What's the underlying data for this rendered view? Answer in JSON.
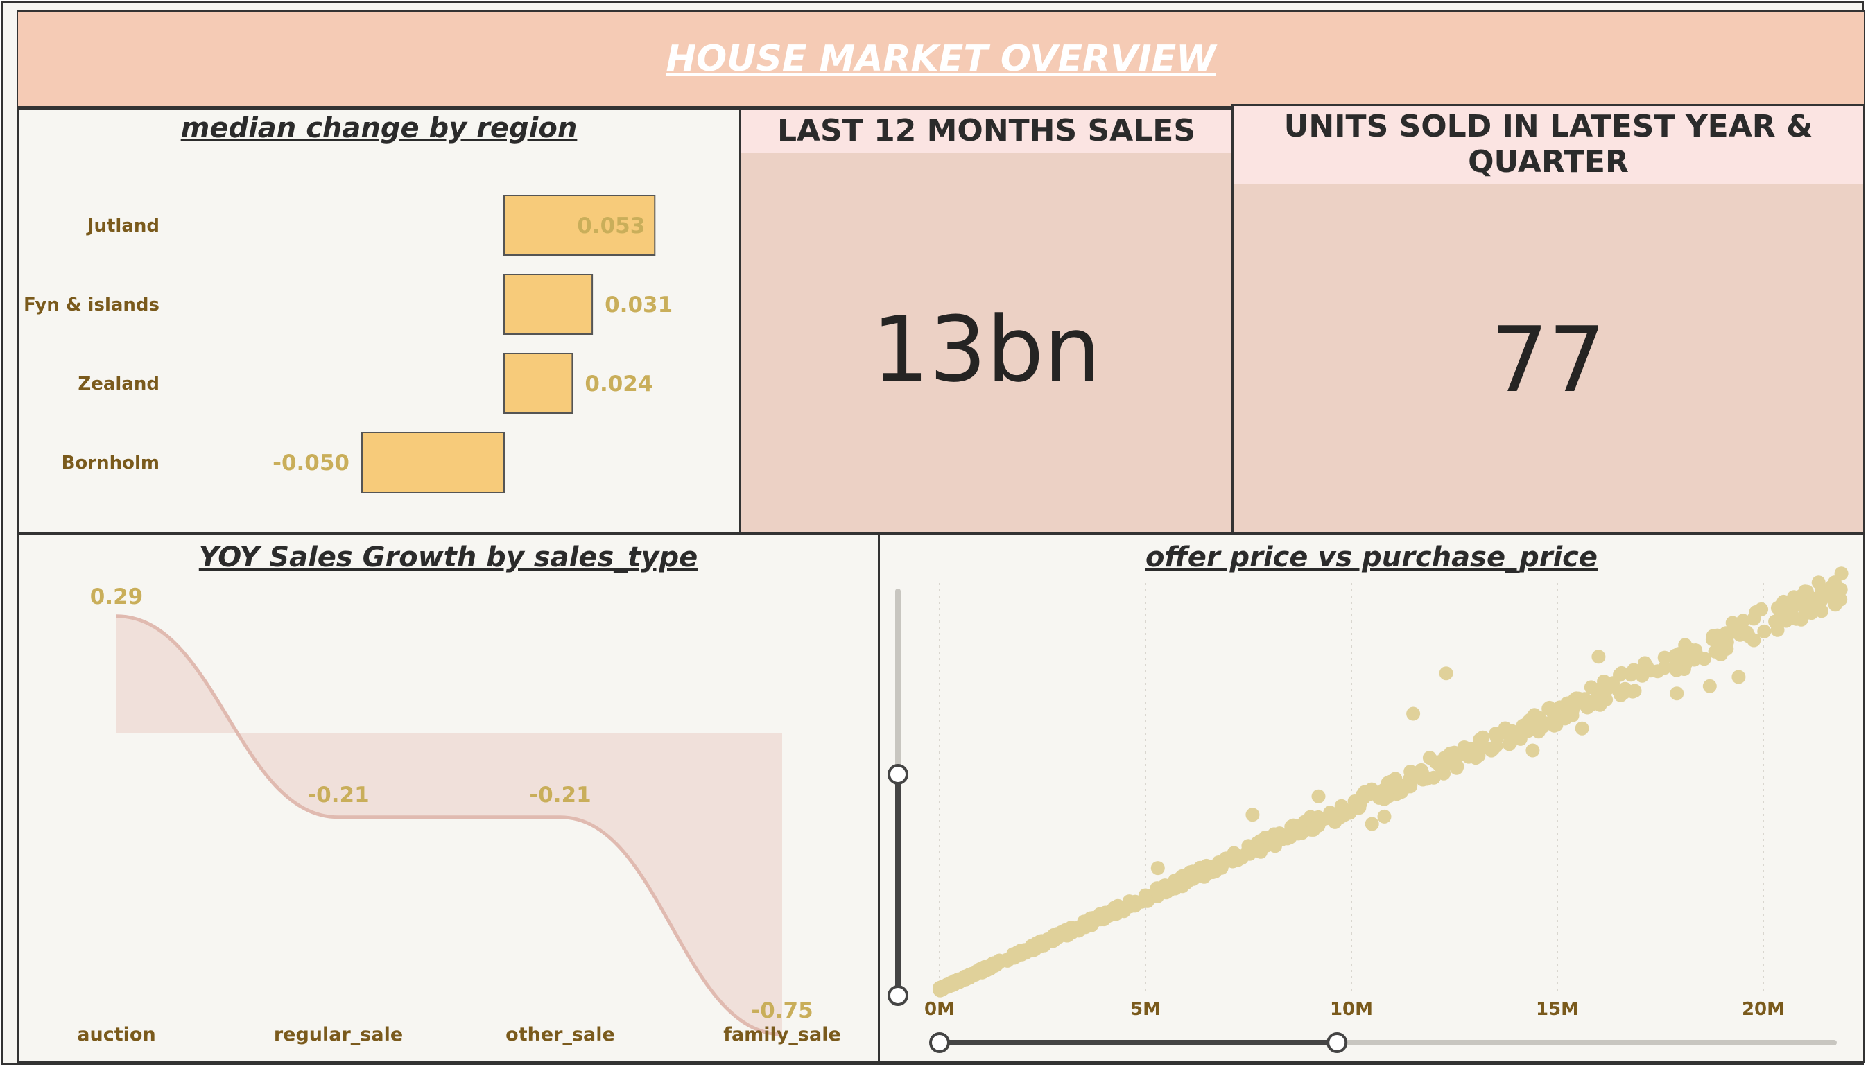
{
  "header": {
    "title": "HOUSE MARKET OVERVIEW"
  },
  "median_change": {
    "title": "median change by region",
    "chart_data": {
      "type": "bar",
      "orientation": "horizontal",
      "categories": [
        "Jutland",
        "Fyn & islands",
        "Zealand",
        "Bornholm"
      ],
      "values": [
        0.053,
        0.031,
        0.024,
        -0.05
      ],
      "labels": [
        "0.053",
        "0.031",
        "0.024",
        "-0.050"
      ],
      "bar_color": "#f7cb7a",
      "label_color": "#c9ae5a",
      "category_color": "#7a5a1c"
    }
  },
  "last12": {
    "title": "LAST 12 MONTHS SALES",
    "value": "13bn"
  },
  "units": {
    "title": "UNITS SOLD IN LATEST YEAR & QUARTER",
    "value": "77"
  },
  "yoy": {
    "title": "YOY Sales Growth by sales_type",
    "chart_data": {
      "type": "area",
      "categories": [
        "auction",
        "regular_sale",
        "other_sale",
        "family_sale"
      ],
      "values": [
        0.29,
        -0.21,
        -0.21,
        -0.75
      ],
      "labels": [
        "0.29",
        "-0.21",
        "-0.21",
        "-0.75"
      ],
      "line_color": "#e0bab0",
      "fill_color": "#f0e0da"
    }
  },
  "scatter": {
    "title": "offer price vs purchase_price",
    "chart_data": {
      "type": "scatter",
      "x_ticks": [
        "0M",
        "5M",
        "10M",
        "15M",
        "20M"
      ],
      "x_tick_values": [
        0,
        5,
        10,
        15,
        20
      ],
      "unit": "M",
      "xlim": [
        0,
        22.2
      ],
      "trend_slope": 1.0,
      "point_color": "#e0d19a",
      "outliers": [
        {
          "x": 12.3,
          "y": 17.2
        },
        {
          "x": 16.0,
          "y": 18.1
        },
        {
          "x": 11.5,
          "y": 15.0
        },
        {
          "x": 12.9,
          "y": 13.1
        },
        {
          "x": 13.8,
          "y": 13.9
        },
        {
          "x": 15.6,
          "y": 14.2
        },
        {
          "x": 17.9,
          "y": 16.1
        },
        {
          "x": 18.7,
          "y": 16.5
        },
        {
          "x": 10.5,
          "y": 9.0
        },
        {
          "x": 10.8,
          "y": 9.4
        },
        {
          "x": 9.6,
          "y": 9.1
        },
        {
          "x": 9.2,
          "y": 10.5
        },
        {
          "x": 7.6,
          "y": 9.5
        },
        {
          "x": 5.3,
          "y": 6.6
        },
        {
          "x": 8.0,
          "y": 8.2
        },
        {
          "x": 14.4,
          "y": 13.0
        },
        {
          "x": 19.4,
          "y": 17.0
        },
        {
          "x": 11.9,
          "y": 12.6
        }
      ],
      "x_slider": {
        "min": 0,
        "max": 9.65
      },
      "y_slider": {
        "min": 0,
        "max": 11.7
      }
    }
  }
}
